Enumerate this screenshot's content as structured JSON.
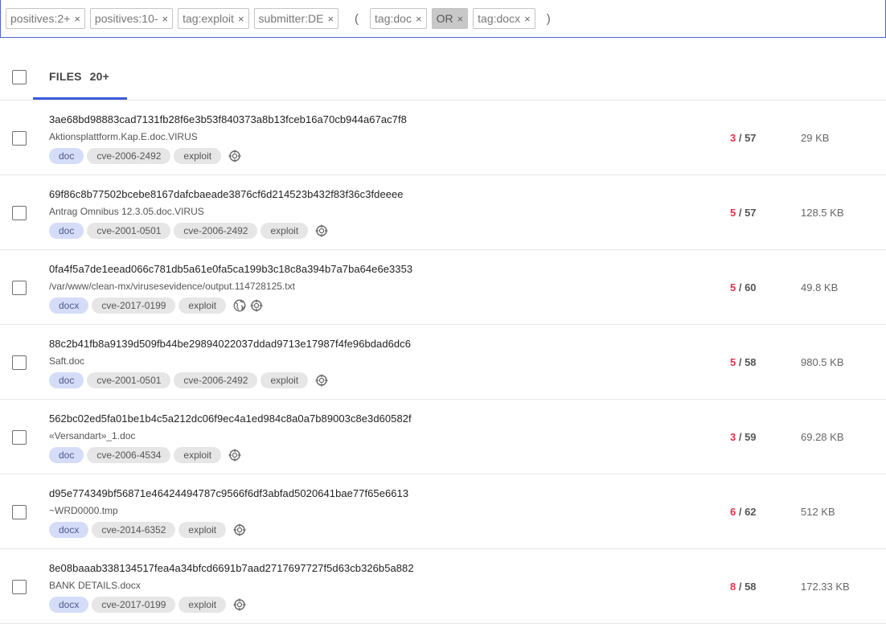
{
  "search": {
    "chips": [
      "positives:2+",
      "positives:10-",
      "tag:exploit",
      "submitter:DE"
    ],
    "open_paren": "(",
    "group_chips": [
      {
        "label": "tag:doc",
        "operator": false
      },
      {
        "label": "OR",
        "operator": true
      },
      {
        "label": "tag:docx",
        "operator": false
      }
    ],
    "close_paren": ")",
    "remove_glyph": "×"
  },
  "header": {
    "tab_label": "FILES",
    "tab_count": "20+"
  },
  "colors": {
    "accent": "#3b5bdb",
    "positive": "#e03149",
    "type_tag_bg": "#d4dcf8"
  },
  "files": [
    {
      "hash": "3ae68bd98883cad7131fb28f6e3b53f840373a8b13fceb16a70cb944a67ac7f8",
      "name": "Aktionsplattform.Kap.E.doc.VIRUS",
      "type": "doc",
      "tags": [
        "cve-2006-2492",
        "exploit"
      ],
      "icons": [
        "crosshair-icon"
      ],
      "positives": "3",
      "total": "/ 57",
      "size": "29 KB"
    },
    {
      "hash": "69f86c8b77502bcebe8167dafcbaeade3876cf6d214523b432f83f36c3fdeeee",
      "name": "Antrag Omnibus 12.3.05.doc.VIRUS",
      "type": "doc",
      "tags": [
        "cve-2001-0501",
        "cve-2006-2492",
        "exploit"
      ],
      "icons": [
        "crosshair-icon"
      ],
      "positives": "5",
      "total": "/ 57",
      "size": "128.5 KB"
    },
    {
      "hash": "0fa4f5a7de1eead066c781db5a61e0fa5ca199b3c18c8a394b7a7ba64e6e3353",
      "name": "/var/www/clean-mx/virusesevidence/output.114728125.txt",
      "type": "docx",
      "tags": [
        "cve-2017-0199",
        "exploit"
      ],
      "icons": [
        "globe-icon",
        "crosshair-icon"
      ],
      "positives": "5",
      "total": "/ 60",
      "size": "49.8 KB"
    },
    {
      "hash": "88c2b41fb8a9139d509fb44be29894022037ddad9713e17987f4fe96bdad6dc6",
      "name": "Saft.doc",
      "type": "doc",
      "tags": [
        "cve-2001-0501",
        "cve-2006-2492",
        "exploit"
      ],
      "icons": [
        "crosshair-icon"
      ],
      "positives": "5",
      "total": "/ 58",
      "size": "980.5 KB"
    },
    {
      "hash": "562bc02ed5fa01be1b4c5a212dc06f9ec4a1ed984c8a0a7b89003c8e3d60582f",
      "name": "«Versandart»_1.doc",
      "type": "doc",
      "tags": [
        "cve-2006-4534",
        "exploit"
      ],
      "icons": [
        "crosshair-icon"
      ],
      "positives": "3",
      "total": "/ 59",
      "size": "69.28 KB"
    },
    {
      "hash": "d95e774349bf56871e46424494787c9566f6df3abfad5020641bae77f65e6613",
      "name": "~WRD0000.tmp",
      "type": "docx",
      "tags": [
        "cve-2014-6352",
        "exploit"
      ],
      "icons": [
        "crosshair-icon"
      ],
      "positives": "6",
      "total": "/ 62",
      "size": "512 KB"
    },
    {
      "hash": "8e08baaab338134517fea4a34bfcd6691b7aad2717697727f5d63cb326b5a882",
      "name": "BANK DETAILS.docx",
      "type": "docx",
      "tags": [
        "cve-2017-0199",
        "exploit"
      ],
      "icons": [
        "crosshair-icon"
      ],
      "positives": "8",
      "total": "/ 58",
      "size": "172.33 KB"
    }
  ]
}
